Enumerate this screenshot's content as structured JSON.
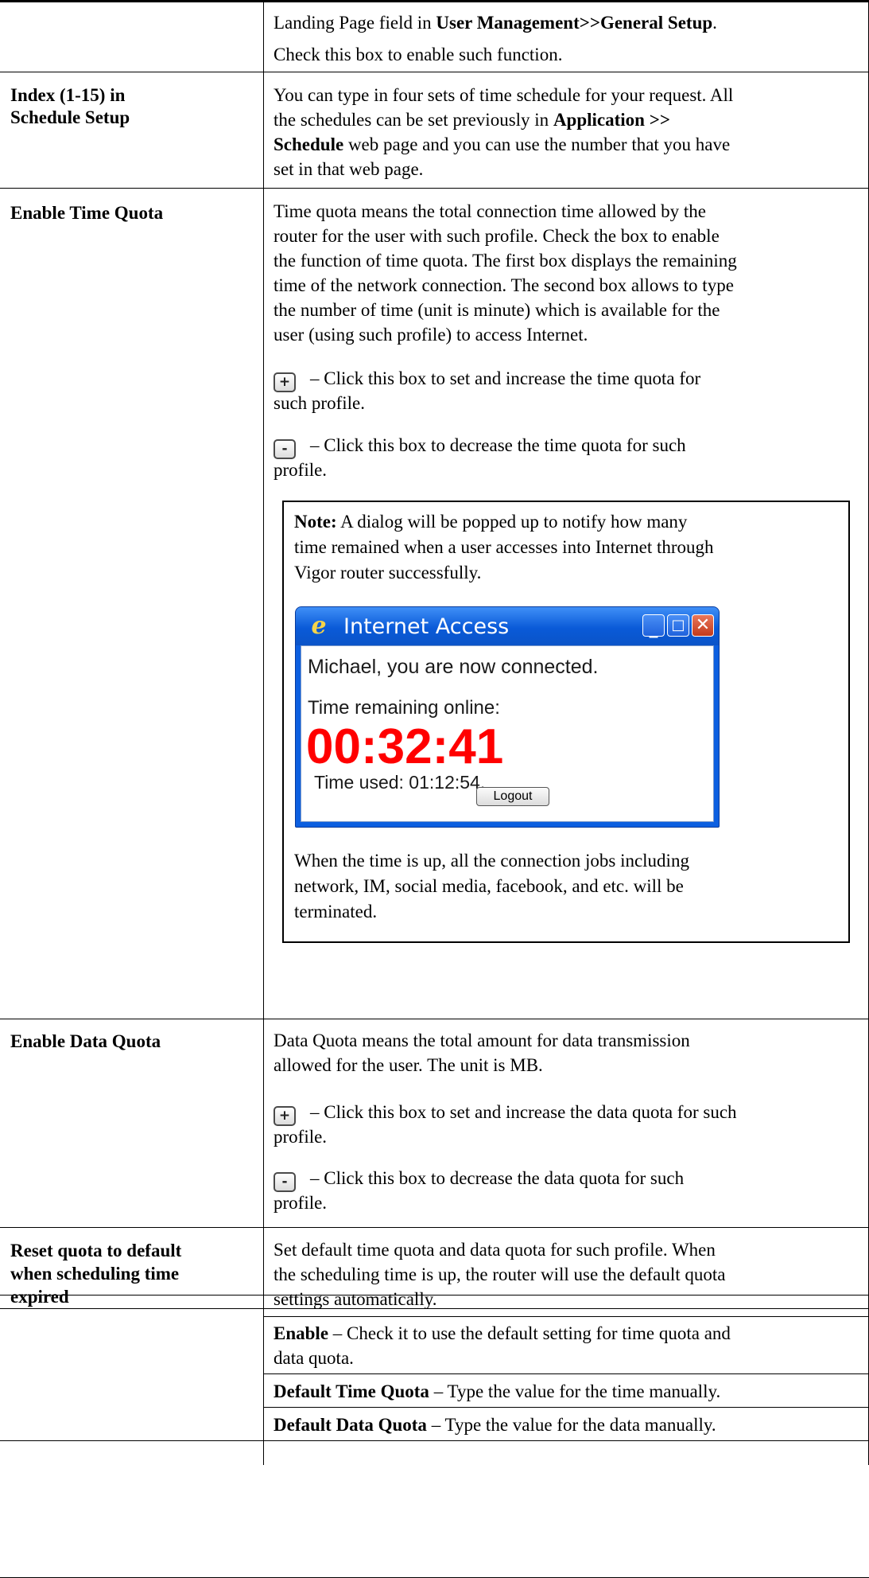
{
  "rows": {
    "top": {
      "line1": {
        "before": "Landing Page field in ",
        "bold": "User Management>>General Setup",
        "after": "."
      },
      "line2": "Check this box to enable such function."
    },
    "index": {
      "label1": "Index (1-15) in",
      "label2": "Schedule Setup",
      "l1": "You can type in four sets of time schedule for your request. All",
      "l2a": "the schedules can be set previously in ",
      "l2b": "Application >>",
      "l3a": "Schedule",
      "l3b": " web page and you can use the number that you have",
      "l4": "set in that web page."
    },
    "time_quota": {
      "label": "Enable Time Quota",
      "p1": [
        "Time quota means the total connection time allowed by the",
        "router for the user with such profile. Check the box to enable",
        "the function of time quota. The first box displays the remaining",
        "time of the network connection. The second box allows to type",
        "the number of time (unit is minute) which is available for the",
        "user (using such profile) to access Internet."
      ],
      "plus_line1": "– Click this box to set and increase the time quota for",
      "plus_line2": "such profile.",
      "minus_line1": "– Click this box to decrease the time quota for such",
      "minus_line2": "profile.",
      "note": {
        "label": "Note:",
        "l1": " A dialog will be popped up to notify how many",
        "l2": "time remained when a user accesses into Internet through",
        "l3": "Vigor router successfully.",
        "after": [
          "When the time is up, all the connection jobs including",
          "network, IM, social media, facebook, and etc. will be",
          "terminated."
        ]
      },
      "dialog": {
        "title": "Internet Access",
        "connected": "Michael, you are now connected.",
        "remaining_label": "Time remaining online:",
        "remaining": "00:32:41",
        "used": "Time used: 01:12:54.",
        "logout": "Logout"
      }
    },
    "data_quota": {
      "label": "Enable Data Quota",
      "l1": "Data Quota means the total amount for data transmission",
      "l2": "allowed for the user. The unit is MB.",
      "plus_line1": "– Click this box to set and increase the data quota for such",
      "plus_line2": "profile.",
      "minus_line1": "– Click this box to decrease the data quota for such",
      "minus_line2": "profile."
    },
    "reset": {
      "label1": "Reset quota to default",
      "label2": "when scheduling time",
      "label3": "expired",
      "l1": "Set default time quota and data quota for such profile. When",
      "l2": "the scheduling time is up, the router will use the default quota",
      "l3": "settings automatically.",
      "enable_bold": "Enable",
      "enable_1": " – Check it to use the default setting for time quota and",
      "enable_2": "data quota.",
      "dtq_bold": "Default Time Quota",
      "dtq": " – Type the value for the time manually.",
      "ddq_bold": "Default Data Quota",
      "ddq": " – Type the value for the data manually."
    }
  },
  "icons": {
    "plus": "+",
    "minus": "-"
  },
  "colors": {
    "timer": "#ff0000",
    "dialog_blue": "#0c5fe0"
  }
}
